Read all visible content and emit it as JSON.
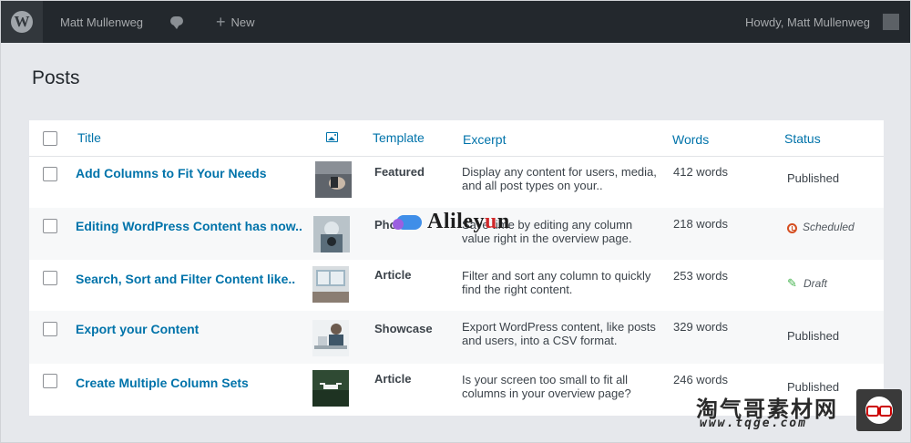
{
  "adminbar": {
    "user": "Matt Mullenweg",
    "new_label": "New",
    "howdy": "Howdy,  Matt Mullenweg",
    "logo_letter": "W"
  },
  "page": {
    "title": "Posts"
  },
  "columns": {
    "title": "Title",
    "template": "Template",
    "excerpt": "Excerpt",
    "words": "Words",
    "status": "Status"
  },
  "rows": [
    {
      "title": "Add Columns to Fit Your Needs",
      "template": "Featured",
      "excerpt": "Display any content for users, media, and all post types on your..",
      "words": "412 words",
      "status": "Published"
    },
    {
      "title": "Editing WordPress Content has now..",
      "template": "Photo",
      "excerpt": "Save time by editing any column value right in the overview page.",
      "words": "218 words",
      "status": "Scheduled"
    },
    {
      "title": "Search, Sort and Filter Content like..",
      "template": "Article",
      "excerpt": "Filter and sort any column to quickly find the right content.",
      "words": "253 words",
      "status": "Draft"
    },
    {
      "title": "Export your Content",
      "template": "Showcase",
      "excerpt": "Export WordPress content, like posts and users, into a CSV format.",
      "words": "329 words",
      "status": "Published"
    },
    {
      "title": "Create Multiple Column Sets",
      "template": "Article",
      "excerpt": "Is your screen too small to fit all columns in your overview page?",
      "words": "246 words",
      "status": "Published"
    }
  ],
  "watermarks": {
    "aliyun_a": "Aliley",
    "aliyun_b": "u",
    "aliyun_c": "n",
    "tqge_cn": "淘气哥素材网",
    "tqge_url": "www.tqge.com"
  },
  "colors": {
    "link": "#0073aa",
    "adminbar": "#23282d",
    "scheduled": "#d54e21",
    "draft": "#46b450"
  }
}
